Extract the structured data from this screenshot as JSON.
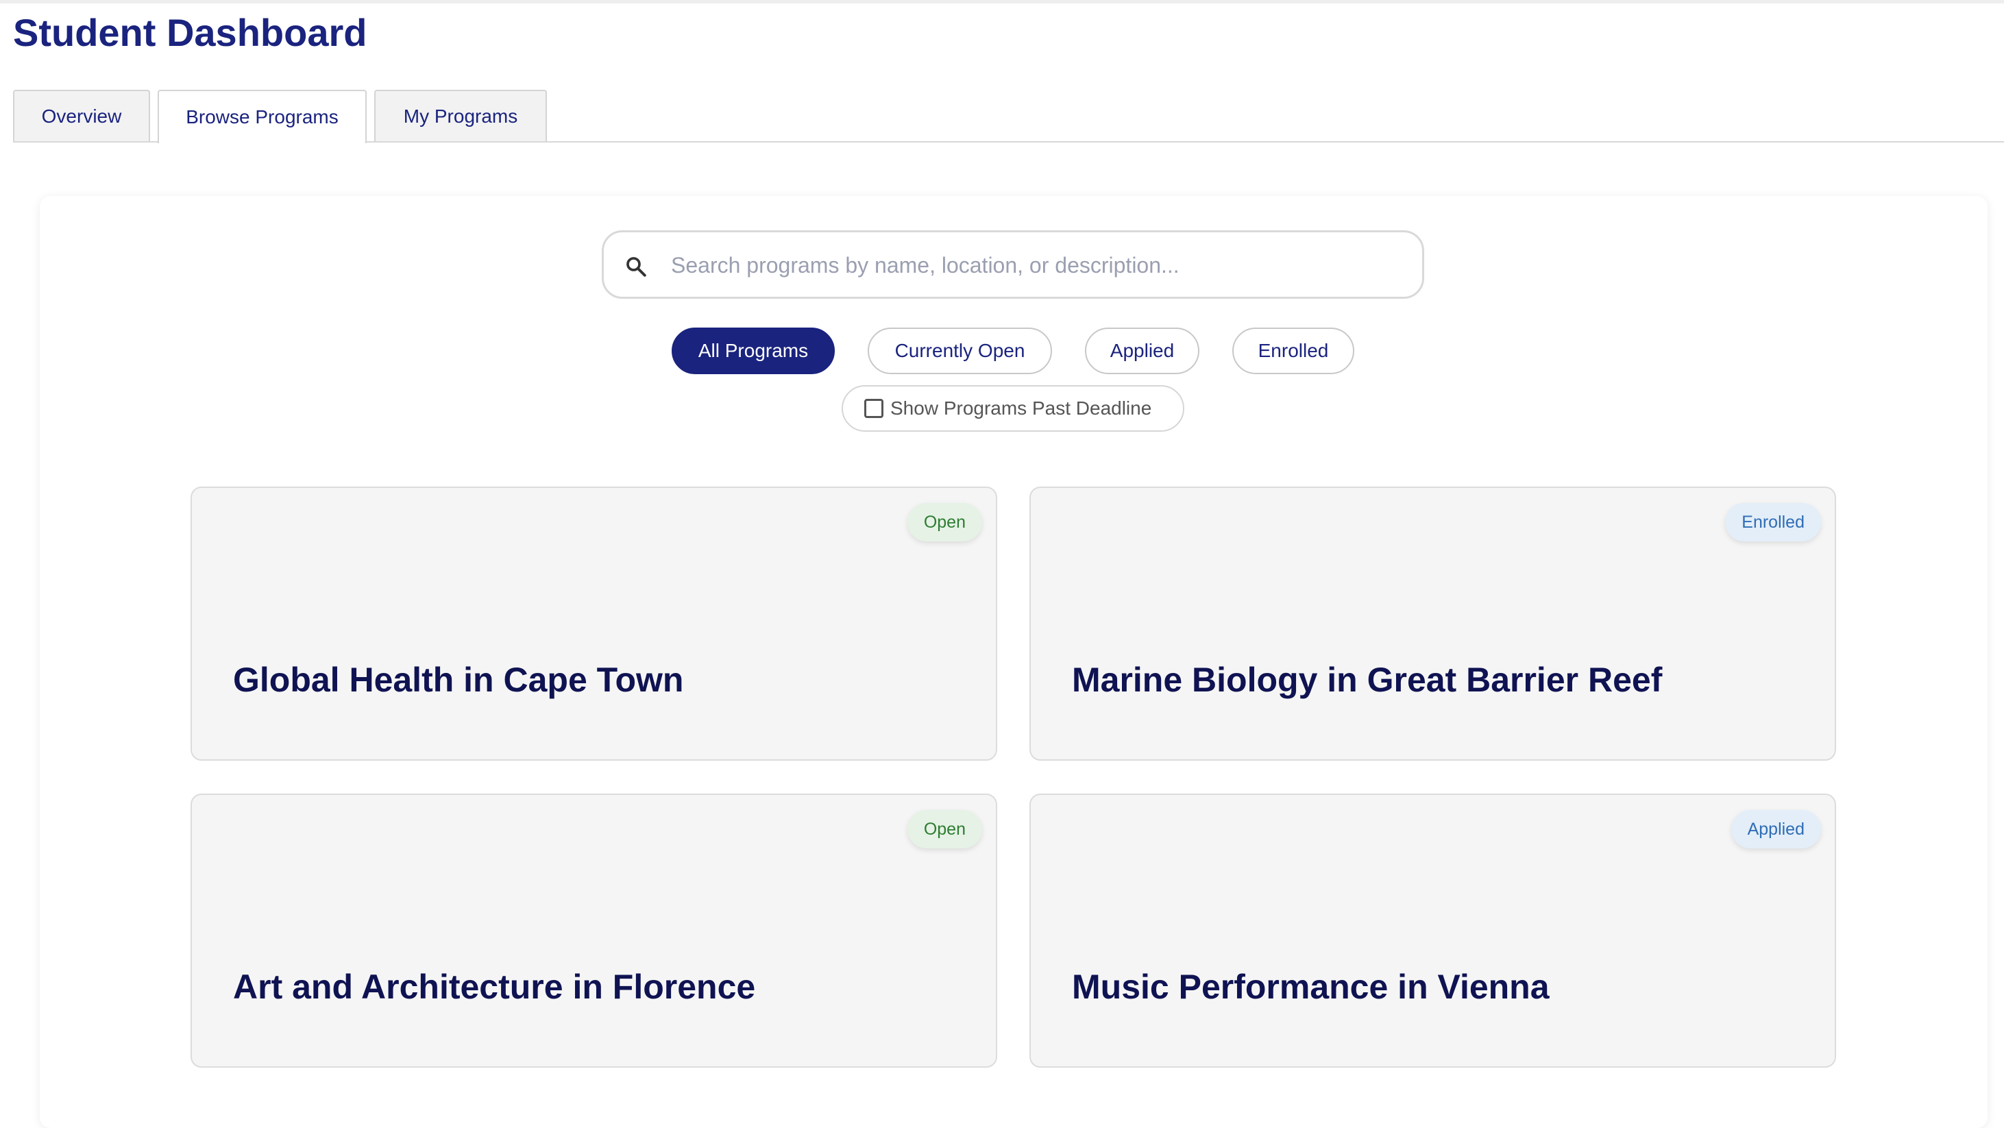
{
  "page": {
    "title": "Student Dashboard"
  },
  "tabs": [
    {
      "label": "Overview",
      "active": false
    },
    {
      "label": "Browse Programs",
      "active": true
    },
    {
      "label": "My Programs",
      "active": false
    }
  ],
  "search": {
    "placeholder": "Search programs by name, location, or description...",
    "value": "",
    "icon": "search-icon"
  },
  "filters": {
    "options": [
      {
        "label": "All Programs",
        "active": true
      },
      {
        "label": "Currently Open",
        "active": false
      },
      {
        "label": "Applied",
        "active": false
      },
      {
        "label": "Enrolled",
        "active": false
      }
    ],
    "past_deadline": {
      "label": "Show Programs Past Deadline",
      "checked": false
    }
  },
  "programs": [
    {
      "title": "Global Health in Cape Town",
      "status": "Open"
    },
    {
      "title": "Marine Biology in Great Barrier Reef",
      "status": "Enrolled"
    },
    {
      "title": "Art and Architecture in Florence",
      "status": "Open"
    },
    {
      "title": "Music Performance in Vienna",
      "status": "Applied"
    }
  ],
  "colors": {
    "brand": "#1a237e",
    "open_badge_bg": "#e6f2e6",
    "open_badge_text": "#2e7d32",
    "info_badge_bg": "#e3eef9",
    "info_badge_text": "#2f6db5"
  }
}
